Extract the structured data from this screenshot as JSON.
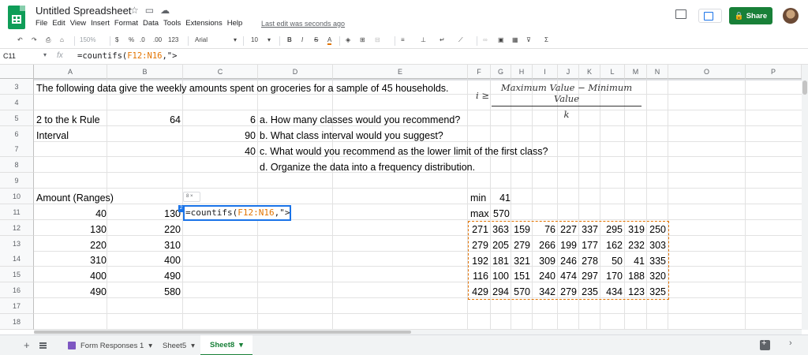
{
  "doc": {
    "title": "Untitled Spreadsheet",
    "last_edit": "Last edit was seconds ago",
    "menu": [
      "File",
      "Edit",
      "View",
      "Insert",
      "Format",
      "Data",
      "Tools",
      "Extensions",
      "Help"
    ]
  },
  "header": {
    "share_label": "Share"
  },
  "toolbar": {
    "zoom": "150%",
    "currency": "$",
    "percent": "%",
    "dec_decrease": ".0",
    "dec_increase": ".00",
    "more_formats": "123",
    "font": "Arial",
    "font_size": "10",
    "bold": "B",
    "italic": "I",
    "strike": "S",
    "text_color": "A",
    "sigma": "Σ"
  },
  "formula_bar": {
    "name_box": "C11",
    "fx": "fx",
    "formula_prefix": "=countifs(",
    "formula_ref": "F12:N16",
    "formula_suffix": ",\">"
  },
  "columns": [
    "A",
    "B",
    "C",
    "D",
    "E",
    "F",
    "G",
    "H",
    "I",
    "J",
    "K",
    "L",
    "M",
    "N",
    "O",
    "P"
  ],
  "rows": [
    "3",
    "4",
    "5",
    "6",
    "7",
    "8",
    "9",
    "10",
    "11",
    "12",
    "13",
    "14",
    "15",
    "16",
    "17",
    "18"
  ],
  "cells": {
    "a3": "The following data give the weekly amounts spent on groceries for a sample of 45 households.",
    "a5": "2 to the k Rule",
    "b5": "64",
    "c5": "6",
    "d5": "a. How many classes would you recommend?",
    "a6": "Interval",
    "c6": "90",
    "d6": "b. What class interval would you suggest?",
    "c7": "40",
    "d7": "c. What would you recommend as the lower limit of the first class?",
    "d8": "d. Organize the data into a frequency distribution.",
    "a10": "Amount (Ranges)",
    "f10": "min",
    "g10": "41",
    "f11": "max",
    "g11": "570",
    "ranges": [
      [
        "40",
        "130"
      ],
      [
        "130",
        "220"
      ],
      [
        "220",
        "310"
      ],
      [
        "310",
        "400"
      ],
      [
        "400",
        "490"
      ],
      [
        "490",
        "580"
      ]
    ],
    "data_grid": [
      [
        "271",
        "363",
        "159",
        "76",
        "227",
        "337",
        "295",
        "319",
        "250"
      ],
      [
        "279",
        "205",
        "279",
        "266",
        "199",
        "177",
        "162",
        "232",
        "303"
      ],
      [
        "192",
        "181",
        "321",
        "309",
        "246",
        "278",
        "50",
        "41",
        "335"
      ],
      [
        "116",
        "100",
        "151",
        "240",
        "474",
        "297",
        "170",
        "188",
        "320"
      ],
      [
        "429",
        "294",
        "570",
        "342",
        "279",
        "235",
        "434",
        "123",
        "325"
      ]
    ]
  },
  "equation": {
    "lhs": "i ≥",
    "numerator": "Maximum Value − Minimum Value",
    "denominator": "k"
  },
  "edit_box": {
    "prefix": "=countifs(",
    "ref": "F12:N16",
    "suffix": ",\">",
    "chip": "8 ×",
    "marker": "2"
  },
  "sheets": [
    {
      "label": "Form Responses 1",
      "active": false
    },
    {
      "label": "Sheet5",
      "active": false
    },
    {
      "label": "Sheet8",
      "active": true
    }
  ]
}
